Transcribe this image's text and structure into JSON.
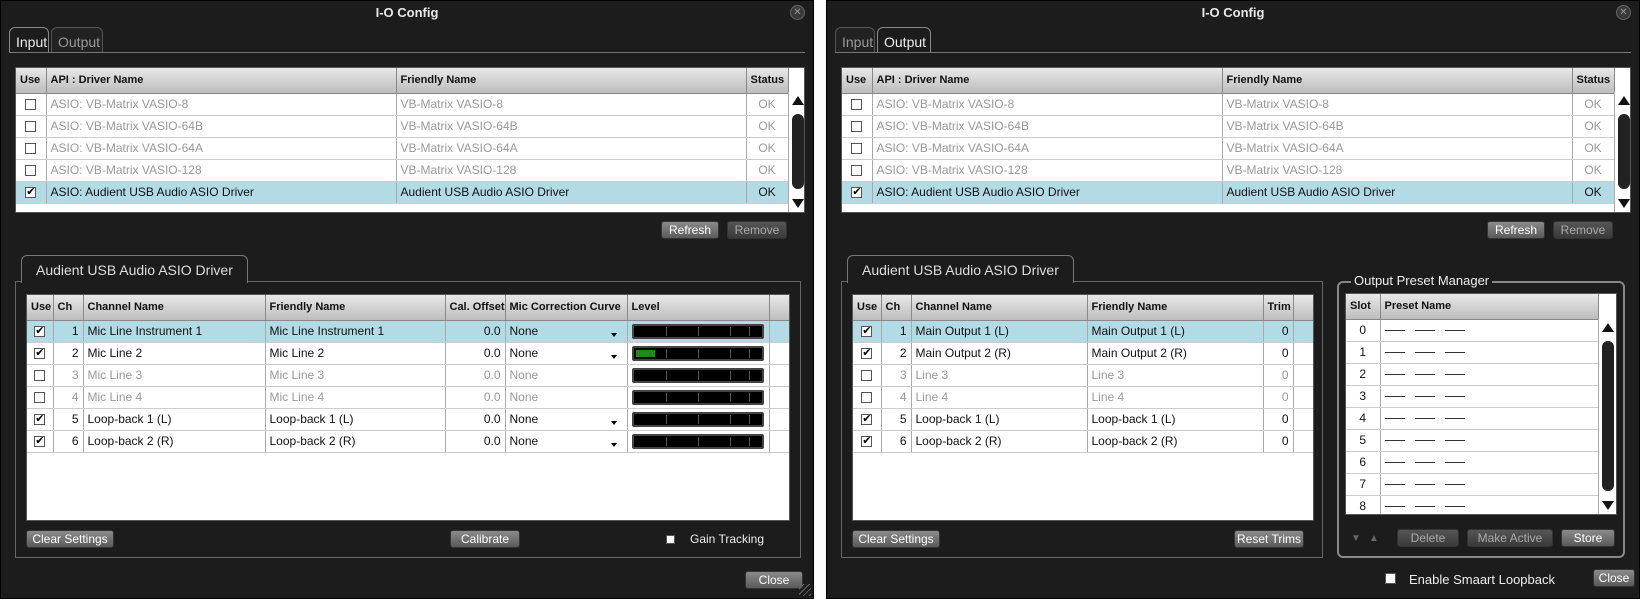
{
  "left": {
    "title": "I-O Config",
    "tabs": [
      "Input",
      "Output"
    ],
    "driver_table": {
      "headers": [
        "Use",
        "API : Driver Name",
        "Friendly Name",
        "Status"
      ],
      "rows": [
        {
          "use": false,
          "api": "ASIO: VB-Matrix VASIO-8",
          "friendly": "VB-Matrix VASIO-8",
          "status": "OK"
        },
        {
          "use": false,
          "api": "ASIO: VB-Matrix VASIO-64B",
          "friendly": "VB-Matrix VASIO-64B",
          "status": "OK"
        },
        {
          "use": false,
          "api": "ASIO: VB-Matrix VASIO-64A",
          "friendly": "VB-Matrix VASIO-64A",
          "status": "OK"
        },
        {
          "use": false,
          "api": "ASIO: VB-Matrix VASIO-128",
          "friendly": "VB-Matrix VASIO-128",
          "status": "OK"
        },
        {
          "use": true,
          "api": "ASIO: Audient USB Audio ASIO Driver",
          "friendly": "Audient USB Audio ASIO Driver",
          "status": "OK"
        }
      ]
    },
    "refresh_label": "Refresh",
    "remove_label": "Remove",
    "sub_tab": "Audient USB Audio ASIO Driver",
    "channel_table": {
      "headers": [
        "Use",
        "Ch",
        "Channel Name",
        "Friendly Name",
        "Cal. Offset",
        "Mic Correction Curve",
        "Level"
      ],
      "rows": [
        {
          "use": true,
          "ch": "1",
          "name": "Mic   Line   Instrument 1",
          "friendly": "Mic   Line   Instrument 1",
          "offset": "0.0",
          "curve": "None",
          "level": 0
        },
        {
          "use": true,
          "ch": "2",
          "name": "Mic   Line 2",
          "friendly": "Mic   Line 2",
          "offset": "0.0",
          "curve": "None",
          "level": 0.15
        },
        {
          "use": false,
          "ch": "3",
          "name": "Mic   Line 3",
          "friendly": "Mic   Line 3",
          "offset": "0.0",
          "curve": "None",
          "level": 0
        },
        {
          "use": false,
          "ch": "4",
          "name": "Mic   Line 4",
          "friendly": "Mic   Line 4",
          "offset": "0.0",
          "curve": "None",
          "level": 0
        },
        {
          "use": true,
          "ch": "5",
          "name": "Loop-back 1 (L)",
          "friendly": "Loop-back 1 (L)",
          "offset": "0.0",
          "curve": "None",
          "level": 0
        },
        {
          "use": true,
          "ch": "6",
          "name": "Loop-back 2 (R)",
          "friendly": "Loop-back 2 (R)",
          "offset": "0.0",
          "curve": "None",
          "level": 0
        }
      ]
    },
    "clear_settings_label": "Clear Settings",
    "calibrate_label": "Calibrate",
    "gain_tracking_label": "Gain Tracking",
    "close_label": "Close"
  },
  "right": {
    "title": "I-O Config",
    "tabs": [
      "Input",
      "Output"
    ],
    "driver_table": {
      "headers": [
        "Use",
        "API : Driver Name",
        "Friendly Name",
        "Status"
      ],
      "rows": [
        {
          "use": false,
          "api": "ASIO: VB-Matrix VASIO-8",
          "friendly": "VB-Matrix VASIO-8",
          "status": "OK"
        },
        {
          "use": false,
          "api": "ASIO: VB-Matrix VASIO-64B",
          "friendly": "VB-Matrix VASIO-64B",
          "status": "OK"
        },
        {
          "use": false,
          "api": "ASIO: VB-Matrix VASIO-64A",
          "friendly": "VB-Matrix VASIO-64A",
          "status": "OK"
        },
        {
          "use": false,
          "api": "ASIO: VB-Matrix VASIO-128",
          "friendly": "VB-Matrix VASIO-128",
          "status": "OK"
        },
        {
          "use": true,
          "api": "ASIO: Audient USB Audio ASIO Driver",
          "friendly": "Audient USB Audio ASIO Driver",
          "status": "OK"
        }
      ]
    },
    "refresh_label": "Refresh",
    "remove_label": "Remove",
    "sub_tab": "Audient USB Audio ASIO Driver",
    "channel_table": {
      "headers": [
        "Use",
        "Ch",
        "Channel Name",
        "Friendly Name",
        "Trim"
      ],
      "rows": [
        {
          "use": true,
          "ch": "1",
          "name": "Main Output 1 (L)",
          "friendly": "Main Output 1 (L)",
          "trim": "0"
        },
        {
          "use": true,
          "ch": "2",
          "name": "Main Output 2 (R)",
          "friendly": "Main Output 2 (R)",
          "trim": "0"
        },
        {
          "use": false,
          "ch": "3",
          "name": "Line 3",
          "friendly": "Line 3",
          "trim": "0"
        },
        {
          "use": false,
          "ch": "4",
          "name": "Line 4",
          "friendly": "Line 4",
          "trim": "0"
        },
        {
          "use": true,
          "ch": "5",
          "name": "Loop-back 1 (L)",
          "friendly": "Loop-back 1 (L)",
          "trim": "0"
        },
        {
          "use": true,
          "ch": "6",
          "name": "Loop-back 2 (R)",
          "friendly": "Loop-back 2 (R)",
          "trim": "0"
        }
      ]
    },
    "clear_settings_label": "Clear Settings",
    "reset_trims_label": "Reset Trims",
    "preset_manager": {
      "title": "Output Preset Manager",
      "headers": [
        "Slot",
        "Preset Name"
      ],
      "slots": [
        "0",
        "1",
        "2",
        "3",
        "4",
        "5",
        "6",
        "7",
        "8"
      ],
      "delete_label": "Delete",
      "make_active_label": "Make Active",
      "store_label": "Store"
    },
    "smaart_loopback_label": "Enable Smaart Loopback",
    "close_label": "Close"
  },
  "colors": {
    "selected_row": "#b3dbe6",
    "meter_fill": "#1d8a1d",
    "window_bg": "#1c1c1c"
  }
}
